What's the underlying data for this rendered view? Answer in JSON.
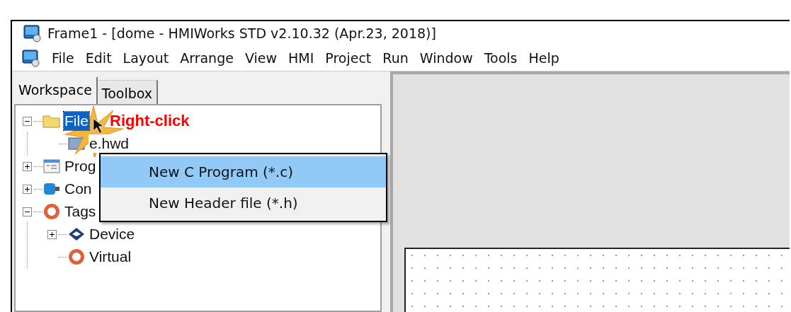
{
  "window": {
    "title": "Frame1 - [dome - HMIWorks STD v2.10.32 (Apr.23, 2018)]"
  },
  "menu_bar": [
    "File",
    "Edit",
    "Layout",
    "Arrange",
    "View",
    "HMI",
    "Project",
    "Run",
    "Window",
    "Tools",
    "Help"
  ],
  "tabs": [
    {
      "label": "Workspace",
      "selected": true
    },
    {
      "label": "Toolbox",
      "selected": false
    }
  ],
  "tree": [
    {
      "label": "File",
      "kind": "folder",
      "expanded": true,
      "selected": true,
      "children": [
        {
          "label": "e.hwd",
          "kind": "document",
          "selected": false
        }
      ]
    },
    {
      "label": "Prog",
      "kind": "program",
      "expanded": false,
      "selected": false
    },
    {
      "label": "Con",
      "kind": "connection",
      "expanded": false,
      "selected": false
    },
    {
      "label": "Tags",
      "kind": "tags",
      "expanded": true,
      "selected": false,
      "children": [
        {
          "label": "Device",
          "kind": "device",
          "expanded": false,
          "selected": false
        },
        {
          "label": "Virtual",
          "kind": "tags",
          "selected": false
        }
      ]
    }
  ],
  "context_menu": [
    {
      "label": "New C Program (*.c)",
      "selected": true
    },
    {
      "label": "New Header file (*.h)",
      "selected": false
    }
  ],
  "annotation": "Right-click"
}
